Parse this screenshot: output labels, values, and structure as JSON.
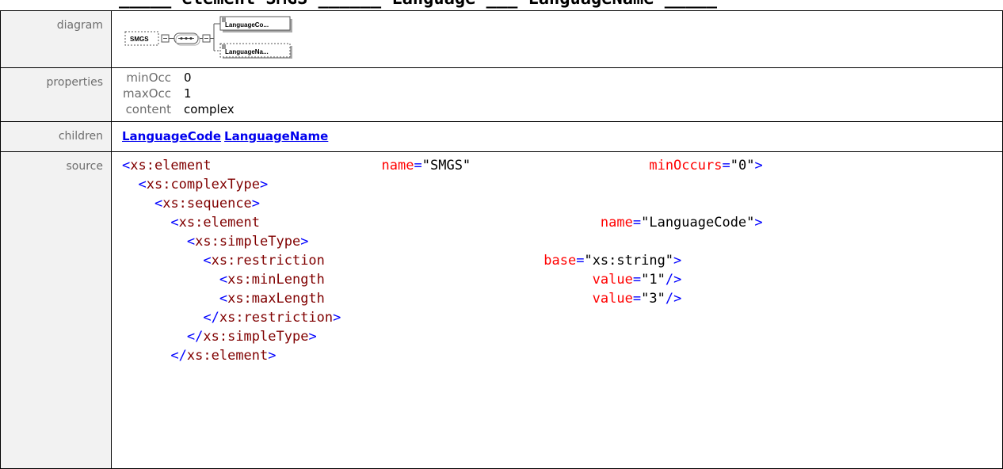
{
  "title_fragment": "_____ element SMGS ______ Language ___ LanguageName _____",
  "rows": {
    "diagram_label": "diagram",
    "properties_label": "properties",
    "children_label": "children",
    "source_label": "source"
  },
  "diagram": {
    "root": "SMGS",
    "child1": "LanguageCo...",
    "child2": "LanguageNa..."
  },
  "properties": [
    {
      "key": "minOcc",
      "value": "0"
    },
    {
      "key": "maxOcc",
      "value": "1"
    },
    {
      "key": "content",
      "value": "complex"
    }
  ],
  "children": [
    "LanguageCode",
    "LanguageName"
  ],
  "source": [
    {
      "indent": 0,
      "open": "<",
      "name": "xs:element",
      "pad": "                     ",
      "attr": "name",
      "val": "\"SMGS\"",
      "pad2": "                      ",
      "attr2": "minOccurs",
      "val2": "\"0\"",
      "close": ">"
    },
    {
      "indent": 2,
      "open": "<",
      "name": "xs:complexType",
      "close": ">"
    },
    {
      "indent": 4,
      "open": "<",
      "name": "xs:sequence",
      "close": ">"
    },
    {
      "indent": 6,
      "open": "<",
      "name": "xs:element",
      "pad": "                                          ",
      "attr": "name",
      "val": "\"LanguageCode\"",
      "close": ">"
    },
    {
      "indent": 8,
      "open": "<",
      "name": "xs:simpleType",
      "close": ">"
    },
    {
      "indent": 10,
      "open": "<",
      "name": "xs:restriction",
      "pad": "                           ",
      "attr": "base",
      "val": "\"xs:string\"",
      "close": ">"
    },
    {
      "indent": 12,
      "open": "<",
      "name": "xs:minLength",
      "pad": "                                 ",
      "attr": "value",
      "val": "\"1\"",
      "close": "/>"
    },
    {
      "indent": 12,
      "open": "<",
      "name": "xs:maxLength",
      "pad": "                                 ",
      "attr": "value",
      "val": "\"3\"",
      "close": "/>"
    },
    {
      "indent": 10,
      "open": "</",
      "name": "xs:restriction",
      "close": ">"
    },
    {
      "indent": 8,
      "open": "</",
      "name": "xs:simpleType",
      "close": ">"
    },
    {
      "indent": 6,
      "open": "</",
      "name": "xs:element",
      "close": ">"
    }
  ]
}
